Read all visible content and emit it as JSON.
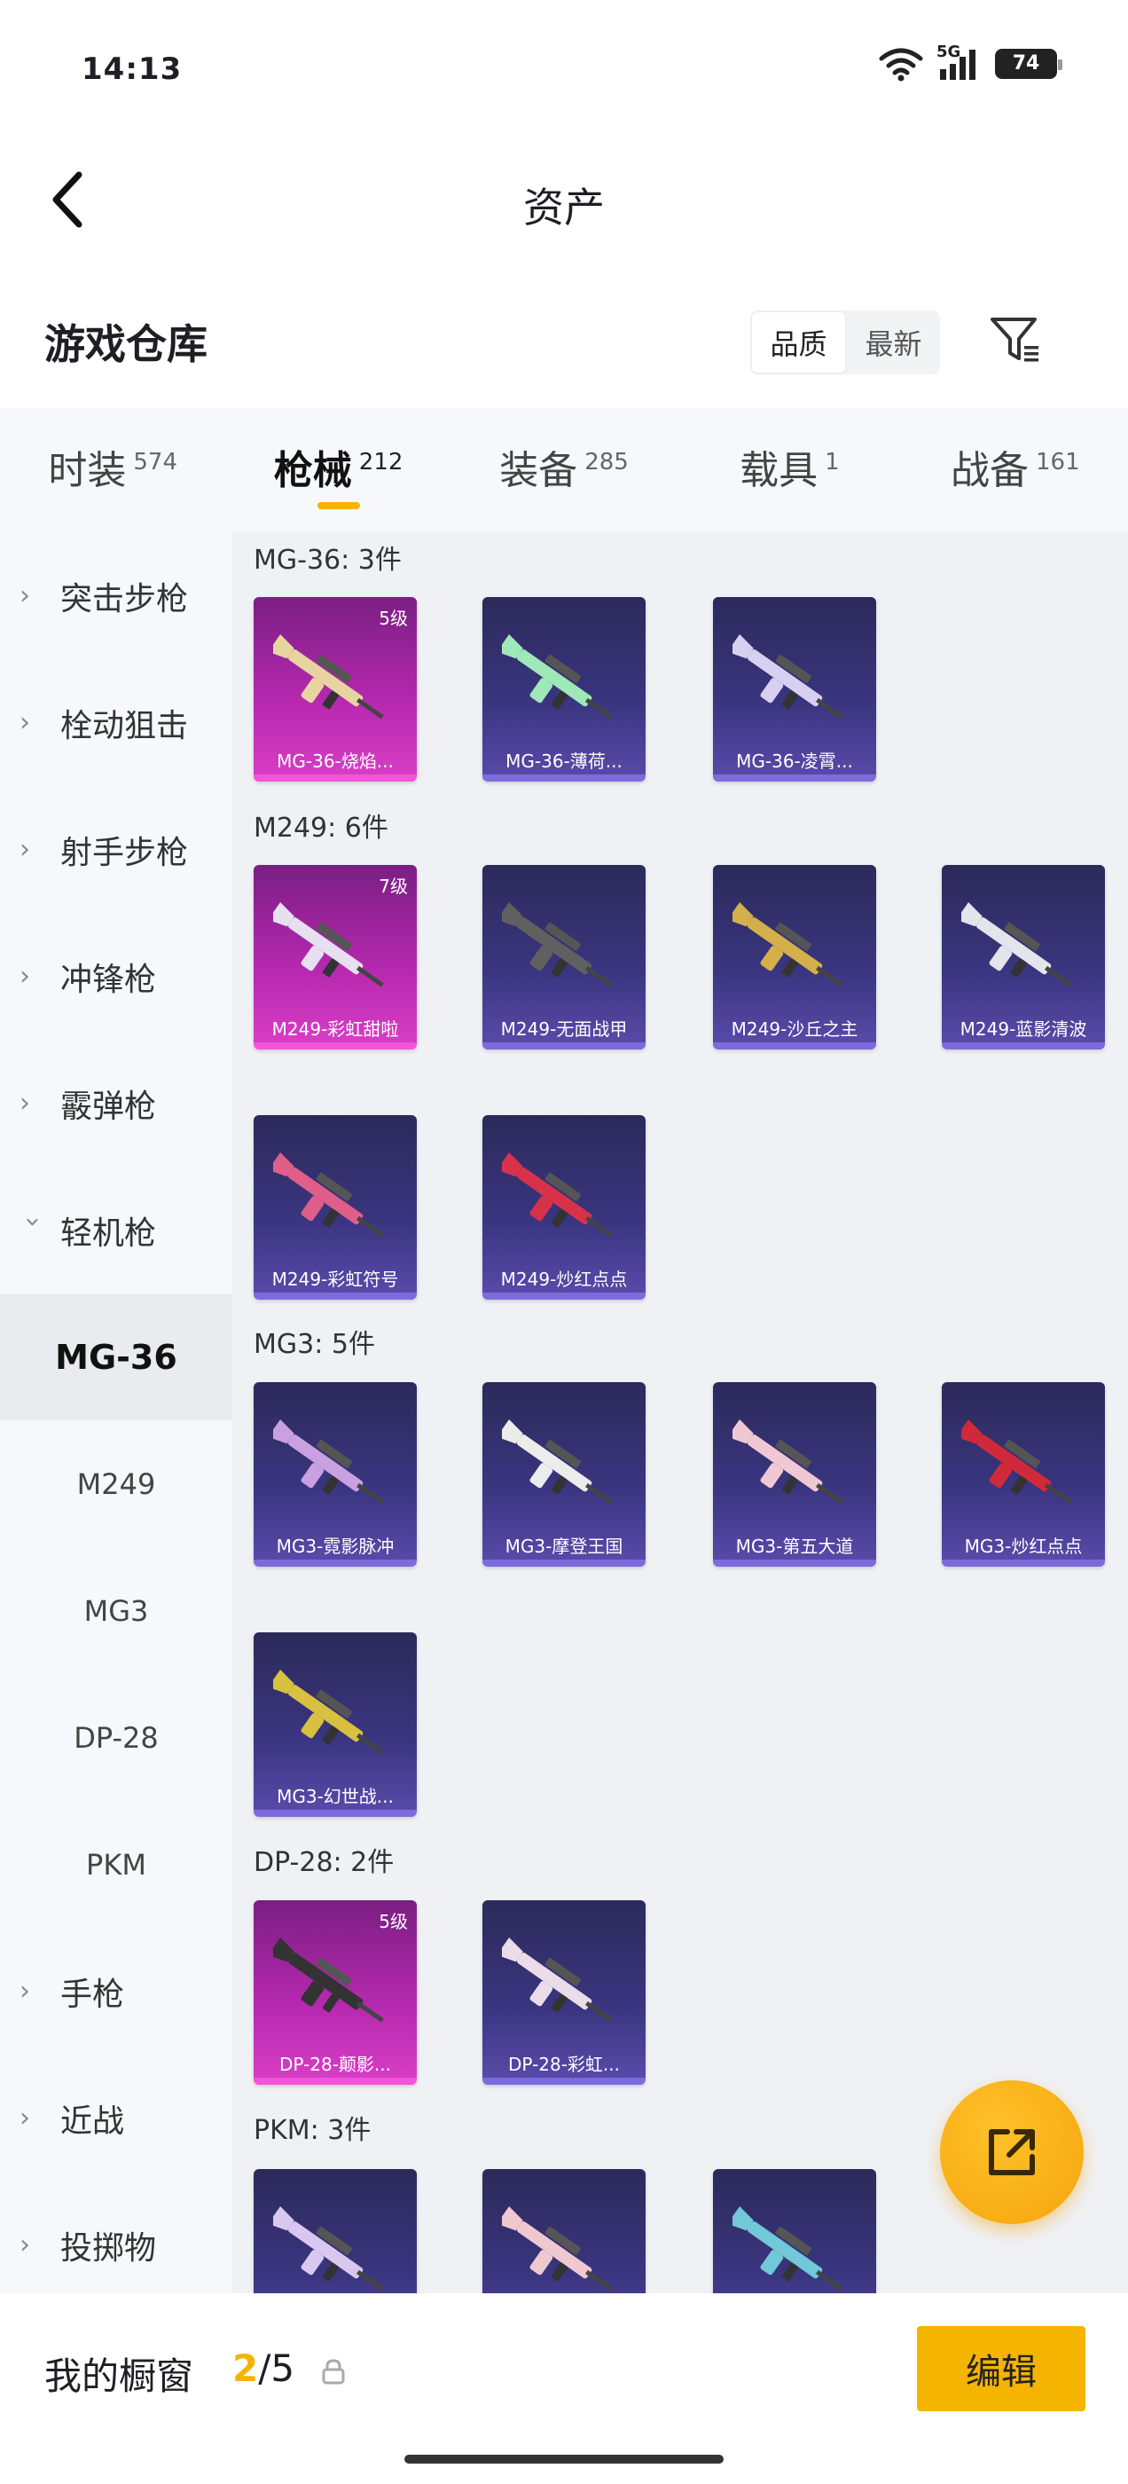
{
  "status_bar": {
    "time": "14:13",
    "network": "5G",
    "battery": "74"
  },
  "nav": {
    "title": "资产"
  },
  "section": {
    "title": "游戏仓库",
    "sort_options": [
      "品质",
      "最新"
    ],
    "active_sort": "品质"
  },
  "tabs": [
    {
      "label": "时装",
      "count": "574"
    },
    {
      "label": "枪械",
      "count": "212"
    },
    {
      "label": "装备",
      "count": "285"
    },
    {
      "label": "载具",
      "count": "1"
    },
    {
      "label": "战备",
      "count": "161"
    }
  ],
  "sidebar": {
    "items": [
      {
        "label": "突击步枪"
      },
      {
        "label": "栓动狙击"
      },
      {
        "label": "射手步枪"
      },
      {
        "label": "冲锋枪"
      },
      {
        "label": "霰弹枪"
      },
      {
        "label": "轻机枪"
      }
    ],
    "sub_items": [
      {
        "label": "MG-36"
      },
      {
        "label": "M249"
      },
      {
        "label": "MG3"
      },
      {
        "label": "DP-28"
      },
      {
        "label": "PKM"
      }
    ],
    "bottom_items": [
      {
        "label": "手枪"
      },
      {
        "label": "近战"
      },
      {
        "label": "投掷物"
      }
    ]
  },
  "groups": [
    {
      "title": "MG-36: 3件",
      "items": [
        {
          "label": "MG-36-烧焰...",
          "level": "5级",
          "rarity": "pink",
          "color": "#e8d4a0"
        },
        {
          "label": "MG-36-薄荷...",
          "level": "",
          "rarity": "purple",
          "color": "#9fe8b8"
        },
        {
          "label": "MG-36-凌霄...",
          "level": "",
          "rarity": "purple",
          "color": "#d8d0f0"
        }
      ]
    },
    {
      "title": "M249: 6件",
      "items": [
        {
          "label": "M249-彩虹甜啦",
          "level": "7级",
          "rarity": "pink",
          "color": "#e6e0f0"
        },
        {
          "label": "M249-无面战甲",
          "level": "",
          "rarity": "purple",
          "color": "#606060"
        },
        {
          "label": "M249-沙丘之主",
          "level": "",
          "rarity": "purple",
          "color": "#d4b04a"
        },
        {
          "label": "M249-蓝影清波",
          "level": "",
          "rarity": "purple",
          "color": "#e4e4ec"
        },
        {
          "label": "M249-彩虹符号",
          "level": "",
          "rarity": "purple",
          "color": "#e05e8a"
        },
        {
          "label": "M249-炒红点点",
          "level": "",
          "rarity": "purple",
          "color": "#d8324a"
        }
      ]
    },
    {
      "title": "MG3: 5件",
      "items": [
        {
          "label": "MG3-霓影脉冲",
          "level": "",
          "rarity": "purple",
          "color": "#c9a0e0"
        },
        {
          "label": "MG3-摩登王国",
          "level": "",
          "rarity": "purple",
          "color": "#ececec"
        },
        {
          "label": "MG3-第五大道",
          "level": "",
          "rarity": "purple",
          "color": "#f0c8d4"
        },
        {
          "label": "MG3-炒红点点",
          "level": "",
          "rarity": "purple",
          "color": "#d02a3a"
        },
        {
          "label": "MG3-幻世战...",
          "level": "",
          "rarity": "purple",
          "color": "#d8c040"
        }
      ]
    },
    {
      "title": "DP-28: 2件",
      "items": [
        {
          "label": "DP-28-颠影...",
          "level": "5级",
          "rarity": "pink",
          "color": "#333333"
        },
        {
          "label": "DP-28-彩虹...",
          "level": "",
          "rarity": "purple",
          "color": "#eadce8"
        }
      ]
    },
    {
      "title": "PKM: 3件",
      "items": [
        {
          "label": "",
          "level": "",
          "rarity": "purple",
          "color": "#d8c8f0"
        },
        {
          "label": "",
          "level": "",
          "rarity": "purple",
          "color": "#f0c8d0"
        },
        {
          "label": "",
          "level": "",
          "rarity": "purple",
          "color": "#70c8d8"
        }
      ]
    }
  ],
  "showcase": {
    "label": "我的橱窗",
    "current": "2",
    "total": "/5"
  },
  "edit_button": {
    "label": "编辑"
  },
  "colors": {
    "accent": "#f5b400",
    "rare_pink": "#d63dc4",
    "rare_purple": "#5849a8"
  }
}
